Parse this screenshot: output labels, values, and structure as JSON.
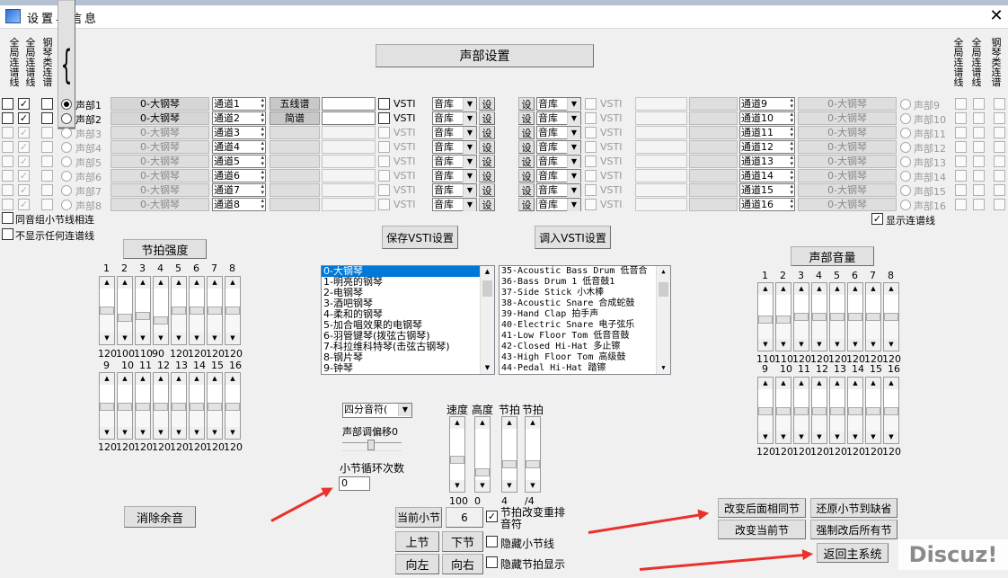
{
  "window": {
    "title": "设置与信息",
    "close": "✕"
  },
  "vlabels": {
    "global_line1": "全局连谱线",
    "global_line2": "全局连谱线",
    "piano_line": "钢琴类连谱",
    "right_global_line1": "全局连谱线",
    "right_global_line2": "全局连谱线",
    "right_piano_line": "钢琴类连谱",
    "brace_char": "{"
  },
  "header": {
    "part_settings": "声部设置"
  },
  "parts_left": [
    {
      "name": "声部1",
      "instrument": "0-大钢琴",
      "channel": "通道1",
      "btn": "五线谱",
      "vsti": "VSTI",
      "library": "音库",
      "set": "设",
      "c1": "",
      "c2": "✓"
    },
    {
      "name": "声部2",
      "instrument": "0-大钢琴",
      "channel": "通道2",
      "btn": "简谱",
      "vsti": "VSTI",
      "library": "音库",
      "set": "设",
      "c1": "",
      "c2": "✓"
    },
    {
      "name": "声部3",
      "instrument": "0-大钢琴",
      "channel": "通道3",
      "btn": "",
      "vsti": "VSTI",
      "library": "音库",
      "set": "设",
      "c1": "",
      "c2": "✓"
    },
    {
      "name": "声部4",
      "instrument": "0-大钢琴",
      "channel": "通道4",
      "btn": "",
      "vsti": "VSTI",
      "library": "音库",
      "set": "设",
      "c1": "",
      "c2": "✓"
    },
    {
      "name": "声部5",
      "instrument": "0-大钢琴",
      "channel": "通道5",
      "btn": "",
      "vsti": "VSTI",
      "library": "音库",
      "set": "设",
      "c1": "",
      "c2": "✓"
    },
    {
      "name": "声部6",
      "instrument": "0-大钢琴",
      "channel": "通道6",
      "btn": "",
      "vsti": "VSTI",
      "library": "音库",
      "set": "设",
      "c1": "",
      "c2": "✓"
    },
    {
      "name": "声部7",
      "instrument": "0-大钢琴",
      "channel": "通道7",
      "btn": "",
      "vsti": "VSTI",
      "library": "音库",
      "set": "设",
      "c1": "",
      "c2": "✓"
    },
    {
      "name": "声部8",
      "instrument": "0-大钢琴",
      "channel": "通道8",
      "btn": "",
      "vsti": "VSTI",
      "library": "音库",
      "set": "设",
      "c1": "",
      "c2": "✓"
    }
  ],
  "parts_right": [
    {
      "name": "声部9",
      "instrument": "0-大钢琴",
      "channel": "通道9",
      "vsti": "VSTI",
      "library": "音库",
      "set": "设"
    },
    {
      "name": "声部10",
      "instrument": "0-大钢琴",
      "channel": "通道10",
      "vsti": "VSTI",
      "library": "音库",
      "set": "设"
    },
    {
      "name": "声部11",
      "instrument": "0-大钢琴",
      "channel": "通道11",
      "vsti": "VSTI",
      "library": "音库",
      "set": "设"
    },
    {
      "name": "声部12",
      "instrument": "0-大钢琴",
      "channel": "通道12",
      "vsti": "VSTI",
      "library": "音库",
      "set": "设"
    },
    {
      "name": "声部13",
      "instrument": "0-大钢琴",
      "channel": "通道13",
      "vsti": "VSTI",
      "library": "音库",
      "set": "设"
    },
    {
      "name": "声部14",
      "instrument": "0-大钢琴",
      "channel": "通道14",
      "vsti": "VSTI",
      "library": "音库",
      "set": "设"
    },
    {
      "name": "声部15",
      "instrument": "0-大钢琴",
      "channel": "通道15",
      "vsti": "VSTI",
      "library": "音库",
      "set": "设"
    },
    {
      "name": "声部16",
      "instrument": "0-大钢琴",
      "channel": "通道16",
      "vsti": "VSTI",
      "library": "音库",
      "set": "设"
    }
  ],
  "options": {
    "same_group_bar": "同音组小节线相连",
    "hide_all_lines": "不显示任何连谱线",
    "show_lines": "显示连谱线",
    "show_lines_checked": "✓"
  },
  "vsti_buttons": {
    "save": "保存VSTI设置",
    "load": "调入VSTI设置"
  },
  "beat_strength": {
    "title": "节拍强度",
    "row1": {
      "nums": [
        "1",
        "2",
        "3",
        "4",
        "5",
        "6",
        "7",
        "8"
      ],
      "values": [
        "120",
        "100",
        "110",
        "90",
        "120",
        "120",
        "120",
        "120"
      ],
      "levels": [
        0.6,
        0.45,
        0.5,
        0.4,
        0.6,
        0.6,
        0.6,
        0.6
      ]
    },
    "row2": {
      "nums": [
        "9",
        "10",
        "11",
        "12",
        "13",
        "14",
        "15",
        "16"
      ],
      "values": [
        "120",
        "120",
        "120",
        "120",
        "120",
        "120",
        "120",
        "120"
      ],
      "levels": [
        0.6,
        0.6,
        0.6,
        0.6,
        0.6,
        0.6,
        0.6,
        0.6
      ]
    }
  },
  "part_volume": {
    "title": "声部音量",
    "row1": {
      "nums": [
        "1",
        "2",
        "3",
        "4",
        "5",
        "6",
        "7",
        "8"
      ],
      "values": [
        "110",
        "110",
        "120",
        "120",
        "120",
        "120",
        "120",
        "120"
      ],
      "levels": [
        0.55,
        0.55,
        0.6,
        0.6,
        0.6,
        0.6,
        0.6,
        0.6
      ]
    },
    "row2": {
      "nums": [
        "9",
        "10",
        "11",
        "12",
        "13",
        "14",
        "15",
        "16"
      ],
      "values": [
        "120",
        "120",
        "120",
        "120",
        "120",
        "120",
        "120",
        "120"
      ],
      "levels": [
        0.6,
        0.6,
        0.6,
        0.6,
        0.6,
        0.6,
        0.6,
        0.6
      ]
    }
  },
  "instrument_list": [
    "0-大钢琴",
    "1-明亮的钢琴",
    "2-电钢琴",
    "3-酒吧钢琴",
    "4-柔和的钢琴",
    "5-加合唱效果的电钢琴",
    "6-羽管键琴(拨弦古钢琴)",
    "7-科拉维科特琴(击弦古钢琴)",
    "8-钢片琴",
    "9-钟琴"
  ],
  "drum_list": [
    "35-Acoustic Bass Drum  低音合",
    "36-Bass Drum 1 低音鼓1",
    "37-Side Stick 小木棒",
    "38-Acoustic Snare 合成蛇鼓",
    "39-Hand Clap 拍手声",
    "40-Electric Snare 电子弦乐",
    "41-Low Floor Tom 低音音鼓",
    "42-Closed Hi-Hat 多止镲",
    "43-High Floor Tom 高级鼓",
    "44-Pedal Hi-Hat 踏镲"
  ],
  "note_select": "四分音符(",
  "transpose": {
    "label": "声部调偏移",
    "value": "0"
  },
  "loop": {
    "label": "小节循环次数",
    "value": "0"
  },
  "tempo_sliders": {
    "labels": [
      "速度",
      "高度",
      "节拍",
      "节拍"
    ],
    "values": [
      "100",
      "0",
      "4",
      "/4"
    ],
    "levels": [
      0.5,
      0.25,
      0.4,
      0.4
    ]
  },
  "bottom": {
    "clear_residual": "消除余音",
    "current_bar": "当前小节",
    "current_bar_value": "6",
    "beat_rearrange": "节拍改变重排音符",
    "beat_rearrange_checked": "✓",
    "prev_bar": "上节",
    "next_bar": "下节",
    "hide_bar_line": "隐藏小节线",
    "left": "向左",
    "right": "向右",
    "hide_beat_display": "隐藏节拍显示",
    "change_following": "改变后面相同节",
    "restore_default": "还原小节到缺省",
    "change_current": "改变当前节",
    "force_change_all": "强制改后所有节",
    "return_main": "返回主系统"
  },
  "watermark": "Discuz!"
}
